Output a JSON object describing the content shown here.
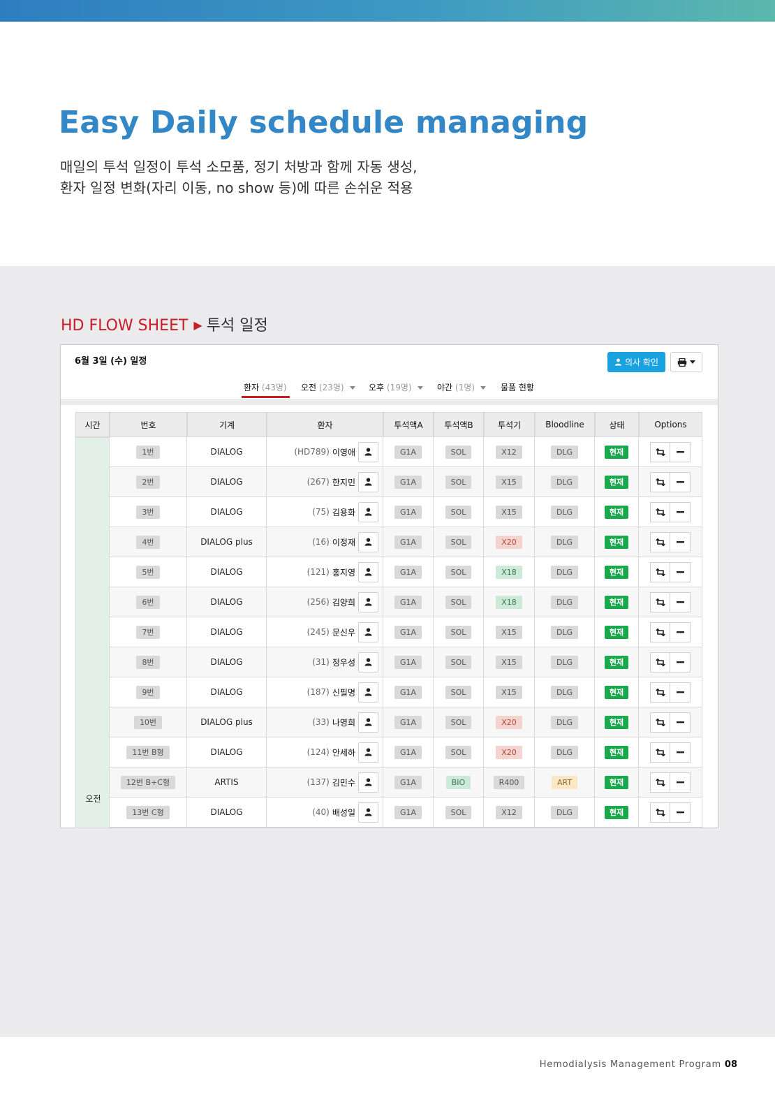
{
  "hero": {
    "title": "Easy Daily schedule managing",
    "desc_line1": "매일의 투석 일정이 투석 소모품, 정기 처방과 함께 자동 생성,",
    "desc_line2": "환자 일정 변화(자리 이동, no show 등)에 따른 손쉬운 적용"
  },
  "section": {
    "red": "HD FLOW SHEET",
    "arrow": "▶",
    "dark": "투석 일정"
  },
  "panel": {
    "date_title": "6월 3일 (수) 일정",
    "doctor_button": "의사 확인",
    "print_icon": "printer-icon"
  },
  "tabs": [
    {
      "label": "환자",
      "count": "(43명)"
    },
    {
      "label": "오전",
      "count": "(23명)"
    },
    {
      "label": "오후",
      "count": "(19명)"
    },
    {
      "label": "야간",
      "count": "(1명)"
    },
    {
      "label": "물품 현황",
      "count": ""
    }
  ],
  "table": {
    "headers": [
      "시간",
      "번호",
      "기계",
      "환자",
      "투석액A",
      "투석액B",
      "투석기",
      "Bloodline",
      "상태",
      "Options"
    ],
    "time_label": "오전",
    "rows": [
      {
        "no": "1번",
        "machine": "DIALOG",
        "pid": "(HD789)",
        "name": "이영애",
        "a": "G1A",
        "b": "SOL",
        "b_style": "",
        "dz": "X12",
        "dz_style": "",
        "bl": "DLG",
        "bl_style": "",
        "status": "현재"
      },
      {
        "no": "2번",
        "machine": "DIALOG",
        "pid": "(267)",
        "name": "한지민",
        "a": "G1A",
        "b": "SOL",
        "b_style": "",
        "dz": "X15",
        "dz_style": "",
        "bl": "DLG",
        "bl_style": "",
        "status": "현재"
      },
      {
        "no": "3번",
        "machine": "DIALOG",
        "pid": "(75)",
        "name": "김용화",
        "a": "G1A",
        "b": "SOL",
        "b_style": "",
        "dz": "X15",
        "dz_style": "",
        "bl": "DLG",
        "bl_style": "",
        "status": "현재"
      },
      {
        "no": "4번",
        "machine": "DIALOG plus",
        "pid": "(16)",
        "name": "이정재",
        "a": "G1A",
        "b": "SOL",
        "b_style": "",
        "dz": "X20",
        "dz_style": "red",
        "bl": "DLG",
        "bl_style": "",
        "status": "현재"
      },
      {
        "no": "5번",
        "machine": "DIALOG",
        "pid": "(121)",
        "name": "홍지영",
        "a": "G1A",
        "b": "SOL",
        "b_style": "",
        "dz": "X18",
        "dz_style": "green",
        "bl": "DLG",
        "bl_style": "",
        "status": "현재"
      },
      {
        "no": "6번",
        "machine": "DIALOG",
        "pid": "(256)",
        "name": "김양희",
        "a": "G1A",
        "b": "SOL",
        "b_style": "",
        "dz": "X18",
        "dz_style": "green",
        "bl": "DLG",
        "bl_style": "",
        "status": "현재"
      },
      {
        "no": "7번",
        "machine": "DIALOG",
        "pid": "(245)",
        "name": "문신우",
        "a": "G1A",
        "b": "SOL",
        "b_style": "",
        "dz": "X15",
        "dz_style": "",
        "bl": "DLG",
        "bl_style": "",
        "status": "현재"
      },
      {
        "no": "8번",
        "machine": "DIALOG",
        "pid": "(31)",
        "name": "정우성",
        "a": "G1A",
        "b": "SOL",
        "b_style": "",
        "dz": "X15",
        "dz_style": "",
        "bl": "DLG",
        "bl_style": "",
        "status": "현재"
      },
      {
        "no": "9번",
        "machine": "DIALOG",
        "pid": "(187)",
        "name": "신필명",
        "a": "G1A",
        "b": "SOL",
        "b_style": "",
        "dz": "X15",
        "dz_style": "",
        "bl": "DLG",
        "bl_style": "",
        "status": "현재"
      },
      {
        "no": "10번",
        "machine": "DIALOG plus",
        "pid": "(33)",
        "name": "나영희",
        "a": "G1A",
        "b": "SOL",
        "b_style": "",
        "dz": "X20",
        "dz_style": "red",
        "bl": "DLG",
        "bl_style": "",
        "status": "현재"
      },
      {
        "no": "11번 B형",
        "machine": "DIALOG",
        "pid": "(124)",
        "name": "안세하",
        "a": "G1A",
        "b": "SOL",
        "b_style": "",
        "dz": "X20",
        "dz_style": "red",
        "bl": "DLG",
        "bl_style": "",
        "status": "현재"
      },
      {
        "no": "12번 B+C형",
        "machine": "ARTIS",
        "pid": "(137)",
        "name": "김민수",
        "a": "G1A",
        "b": "BIO",
        "b_style": "green",
        "dz": "R400",
        "dz_style": "",
        "bl": "ART",
        "bl_style": "orange",
        "status": "현재"
      },
      {
        "no": "13번 C형",
        "machine": "DIALOG",
        "pid": "(40)",
        "name": "배성일",
        "a": "G1A",
        "b": "SOL",
        "b_style": "",
        "dz": "X12",
        "dz_style": "",
        "bl": "DLG",
        "bl_style": "",
        "status": "현재"
      }
    ]
  },
  "footer": {
    "text": "Hemodialysis Management Program",
    "page": "08"
  },
  "colors": {
    "title_blue": "#3487c6",
    "accent_red": "#c81d25",
    "status_green": "#19a84b",
    "button_blue": "#1aa2e0"
  }
}
